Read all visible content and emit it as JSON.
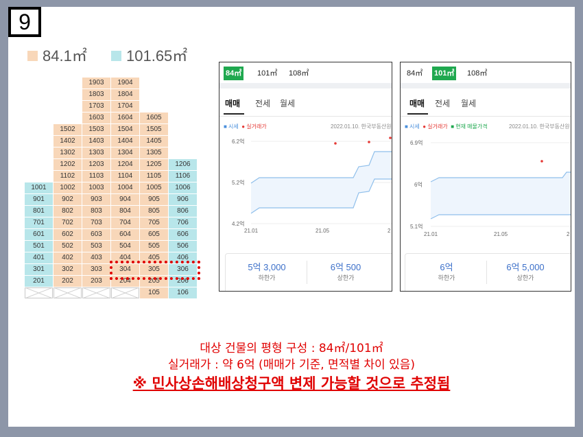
{
  "slide_number": "9",
  "legend": {
    "size_a": "84.1㎡",
    "size_b": "101.65㎡",
    "color_a": "#f8d7b9",
    "color_b": "#b8e6ea"
  },
  "building": {
    "columns": [
      "col1",
      "col2",
      "col3",
      "col4",
      "col5",
      "col6"
    ],
    "floors": [
      {
        "units": [
          null,
          null,
          "1903",
          "1904",
          null,
          null
        ]
      },
      {
        "units": [
          null,
          null,
          "1803",
          "1804",
          null,
          null
        ]
      },
      {
        "units": [
          null,
          null,
          "1703",
          "1704",
          null,
          null
        ]
      },
      {
        "units": [
          null,
          null,
          "1603",
          "1604",
          "1605",
          null
        ]
      },
      {
        "units": [
          null,
          "1502",
          "1503",
          "1504",
          "1505",
          null
        ]
      },
      {
        "units": [
          null,
          "1402",
          "1403",
          "1404",
          "1405",
          null
        ]
      },
      {
        "units": [
          null,
          "1302",
          "1303",
          "1304",
          "1305",
          null
        ]
      },
      {
        "units": [
          null,
          "1202",
          "1203",
          "1204",
          "1205",
          "1206"
        ]
      },
      {
        "units": [
          null,
          "1102",
          "1103",
          "1104",
          "1105",
          "1106"
        ]
      },
      {
        "units": [
          "1001",
          "1002",
          "1003",
          "1004",
          "1005",
          "1006"
        ]
      },
      {
        "units": [
          "901",
          "902",
          "903",
          "904",
          "905",
          "906"
        ]
      },
      {
        "units": [
          "801",
          "802",
          "803",
          "804",
          "805",
          "806"
        ]
      },
      {
        "units": [
          "701",
          "702",
          "703",
          "704",
          "705",
          "706"
        ]
      },
      {
        "units": [
          "601",
          "602",
          "603",
          "604",
          "605",
          "606"
        ]
      },
      {
        "units": [
          "501",
          "502",
          "503",
          "504",
          "505",
          "506"
        ]
      },
      {
        "units": [
          "401",
          "402",
          "403",
          "404",
          "405",
          "406"
        ]
      },
      {
        "units": [
          "301",
          "302",
          "303",
          "304",
          "305",
          "306"
        ]
      },
      {
        "units": [
          "201",
          "202",
          "203",
          "204",
          "205",
          "206"
        ]
      },
      {
        "units": [
          "",
          "",
          "",
          "",
          "105",
          "106"
        ]
      }
    ],
    "col_size": [
      "b",
      "a",
      "a",
      "a",
      "a",
      "b"
    ],
    "highlighted_units": [
      "404",
      "405",
      "406"
    ]
  },
  "panel_84": {
    "size_tabs": [
      "84㎡",
      "101㎡",
      "108㎡"
    ],
    "active_size": 0,
    "trade_tabs": [
      "매매",
      "전세",
      "월세"
    ],
    "legend_market": "■ 시세",
    "legend_actual": "● 실거래가",
    "date_source": "2022.01.10. 한국부동산원",
    "y_ticks": [
      "6.2억",
      "5.2억",
      "4.2억"
    ],
    "x_ticks": [
      "21.01",
      "21.05",
      "2"
    ],
    "summary": [
      {
        "value": "5억 3,000",
        "label": "하한가"
      },
      {
        "value": "6억 500",
        "label": "상한가"
      }
    ]
  },
  "panel_101": {
    "size_tabs": [
      "84㎡",
      "101㎡",
      "108㎡"
    ],
    "active_size": 1,
    "trade_tabs": [
      "매매",
      "전세",
      "월세"
    ],
    "legend_market": "■ 시세",
    "legend_actual": "● 실거래가",
    "legend_listing": "■ 현재 매물가격",
    "date_source": "2022.01.10. 한국부동산원",
    "y_ticks": [
      "6.9억",
      "6억",
      "5.1억"
    ],
    "x_ticks": [
      "21.01",
      "21.05",
      "2"
    ],
    "summary": [
      {
        "value": "6억",
        "label": "하한가"
      },
      {
        "value": "6억 5,000",
        "label": "상한가"
      }
    ]
  },
  "caption": {
    "line1": "대상 건물의 평형 구성 : 84㎡/101㎡",
    "line2": "실거래가 : 약 6억 (매매가 기준, 면적별 차이 있음)",
    "line3": "※ 민사상손해배상청구액 변제 가능할 것으로 추정됨"
  }
}
